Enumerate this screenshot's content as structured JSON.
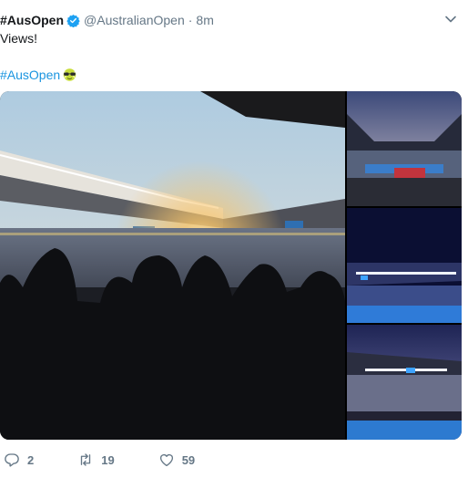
{
  "author": {
    "display_name": "#AusOpen",
    "handle": "@AustralianOpen",
    "separator": "·",
    "timestamp": "8m",
    "verified_icon": "verified-badge-icon"
  },
  "tweet": {
    "text": "Views!",
    "hashtag": "#AusOpen",
    "emoji_icon": "tennis-ball-sunglasses-emoji"
  },
  "media": {
    "photos": [
      "stadium-sunset-crowd-silhouette",
      "stadium-roof-crowd-dusk",
      "stadium-night-lights-court",
      "stadium-evening-wide-court"
    ]
  },
  "actions": {
    "reply_count": "2",
    "retweet_count": "19",
    "like_count": "59"
  },
  "colors": {
    "link": "#1b95e0",
    "verified": "#1da1f2",
    "muted": "#657786",
    "text": "#14171a"
  }
}
